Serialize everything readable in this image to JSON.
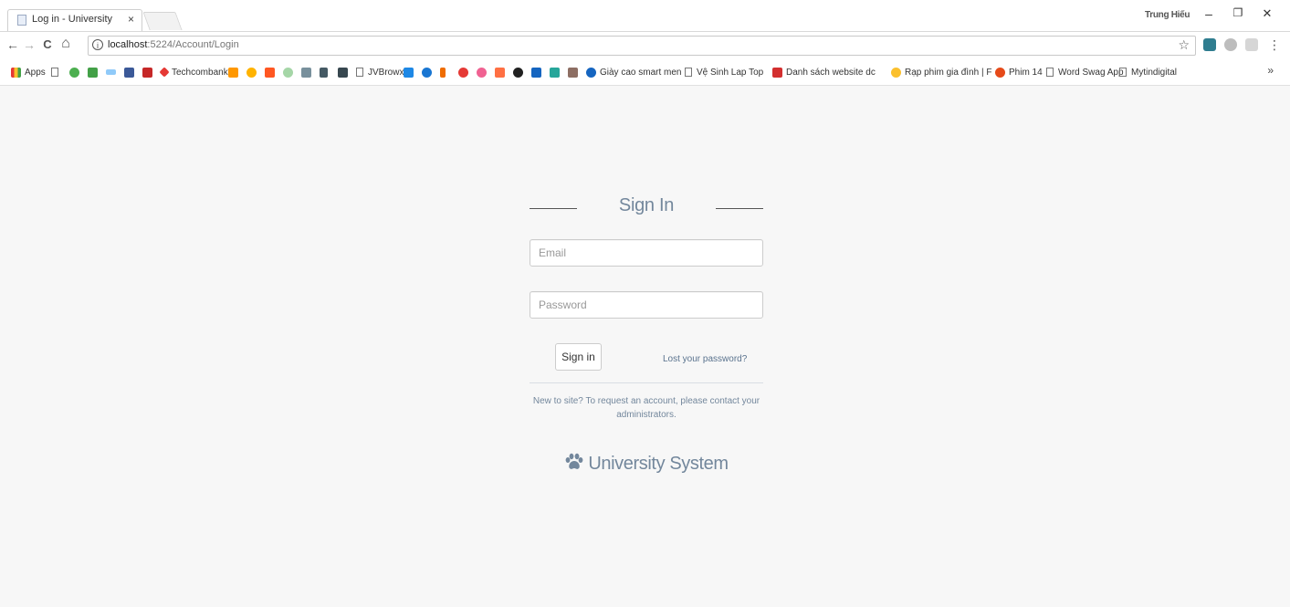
{
  "browser": {
    "tab_title": "Log in - University",
    "tab_close": "×",
    "profile_name": "Trung Hiếu",
    "window_controls": {
      "minimize": "–",
      "restore": "❐",
      "close": "✕"
    },
    "nav": {
      "back": "←",
      "forward": "→",
      "reload": "C",
      "home": "⌂"
    },
    "url_host": "localhost",
    "url_path": ":5224/Account/Login",
    "star": "☆",
    "more": "⋮"
  },
  "bookmarks": {
    "apps_label": "Apps",
    "techcombank": "Techcombank",
    "jvbrowxy": "JVBrowxy",
    "giay": "Giày cao smart men",
    "vesinh": "Vệ Sinh Lap Top",
    "danhsach": "Danh sách website dc",
    "rap": "Rạp phim gia đình | F",
    "phim14": "Phim 14",
    "wordswag": "Word Swag App",
    "mytindigital": "Mytindigital",
    "more": "»"
  },
  "login": {
    "title": "Sign In",
    "email_placeholder": "Email",
    "password_placeholder": "Password",
    "signin_label": "Sign in",
    "lost_password": "Lost your password?",
    "note": "New to site? To request an account, please contact your administrators.",
    "brand": "University System"
  },
  "colors": {
    "page_bg": "#f7f7f7",
    "muted_text": "#73879c",
    "link": "#5a738e"
  }
}
